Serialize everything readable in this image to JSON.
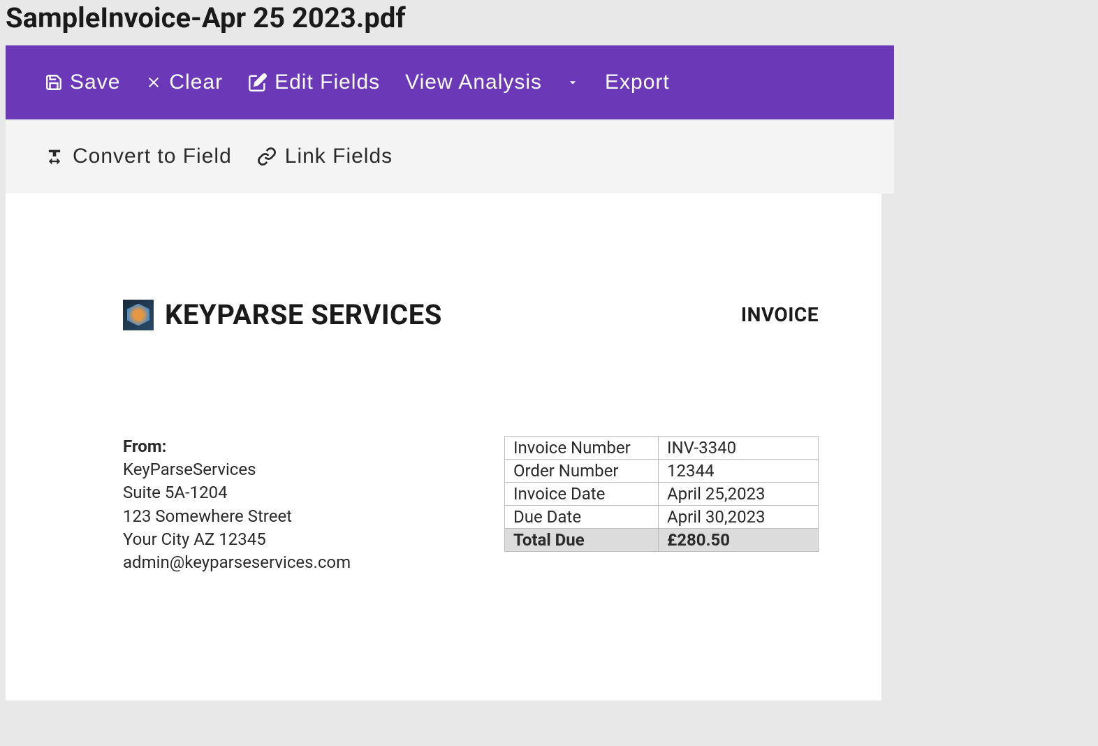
{
  "page": {
    "title": "SampleInvoice-Apr 25 2023.pdf"
  },
  "toolbar": {
    "save_label": "Save",
    "clear_label": "Clear",
    "edit_fields_label": "Edit Fields",
    "view_analysis_label": "View Analysis",
    "export_label": "Export"
  },
  "secondary_toolbar": {
    "convert_label": "Convert to Field",
    "link_label": "Link Fields"
  },
  "document": {
    "company_name": "KEYPARSE SERVICES",
    "doc_type": "INVOICE",
    "from": {
      "label": "From:",
      "company": "KeyParseServices",
      "suite": "Suite 5A-1204",
      "street": "123 Somewhere Street",
      "city": "Your City AZ 12345",
      "email": "admin@keyparseservices.com"
    },
    "meta": [
      {
        "label": "Invoice Number",
        "value": "INV-3340"
      },
      {
        "label": "Order Number",
        "value": "12344"
      },
      {
        "label": "Invoice Date",
        "value": "April 25,2023"
      },
      {
        "label": "Due Date",
        "value": "April 30,2023"
      },
      {
        "label": "Total Due",
        "value": "£280.50",
        "total": true
      }
    ]
  }
}
